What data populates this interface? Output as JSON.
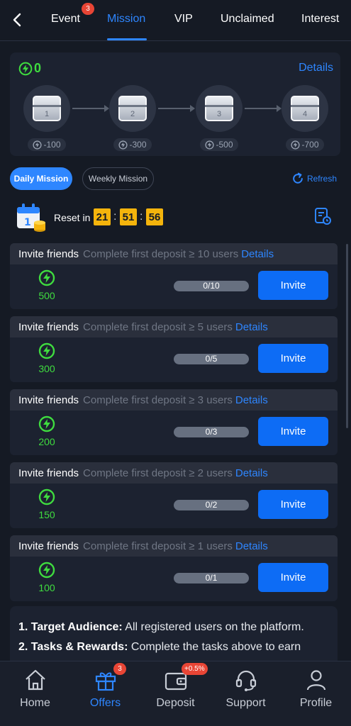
{
  "nav": {
    "tabs": [
      {
        "label": "Event",
        "badge": "3"
      },
      {
        "label": "Mission"
      },
      {
        "label": "VIP"
      },
      {
        "label": "Unclaimed"
      },
      {
        "label": "Interest"
      }
    ],
    "active_tab": "Mission"
  },
  "chests": {
    "energy": "0",
    "details_label": "Details",
    "items": [
      {
        "number": "1",
        "cost": "-100"
      },
      {
        "number": "2",
        "cost": "-300"
      },
      {
        "number": "3",
        "cost": "-500"
      },
      {
        "number": "4",
        "cost": "-700"
      }
    ]
  },
  "mission_tabs": {
    "daily": "Daily Mission",
    "weekly": "Weekly Mission",
    "refresh": "Refresh"
  },
  "timer": {
    "label": "Reset in",
    "hours": "21",
    "minutes": "51",
    "seconds": "56"
  },
  "missions": [
    {
      "title": "Invite friends",
      "desc": "Complete first deposit ≥ 10 users",
      "details": "Details",
      "reward": "500",
      "progress": "0/10",
      "button": "Invite"
    },
    {
      "title": "Invite friends",
      "desc": "Complete first deposit ≥ 5 users",
      "details": "Details",
      "reward": "300",
      "progress": "0/5",
      "button": "Invite"
    },
    {
      "title": "Invite friends",
      "desc": "Complete first deposit ≥ 3 users",
      "details": "Details",
      "reward": "200",
      "progress": "0/3",
      "button": "Invite"
    },
    {
      "title": "Invite friends",
      "desc": "Complete first deposit ≥ 2 users",
      "details": "Details",
      "reward": "150",
      "progress": "0/2",
      "button": "Invite"
    },
    {
      "title": "Invite friends",
      "desc": "Complete first deposit ≥ 1 users",
      "details": "Details",
      "reward": "100",
      "progress": "0/1",
      "button": "Invite"
    }
  ],
  "rules": {
    "item1_label": "1. Target Audience:",
    "item1_text": " All registered users on the platform.",
    "item2_label": "2. Tasks & Rewards:",
    "item2_text": " Complete the tasks above to earn"
  },
  "bottom_nav": {
    "home": "Home",
    "offers": "Offers",
    "offers_badge": "3",
    "deposit": "Deposit",
    "deposit_badge": "+0.5%",
    "support": "Support",
    "profile": "Profile"
  },
  "colors": {
    "accent": "#2e86ff",
    "energy_green": "#3fdc3f",
    "timer_yellow": "#f4b40c",
    "badge_red": "#e84535"
  }
}
